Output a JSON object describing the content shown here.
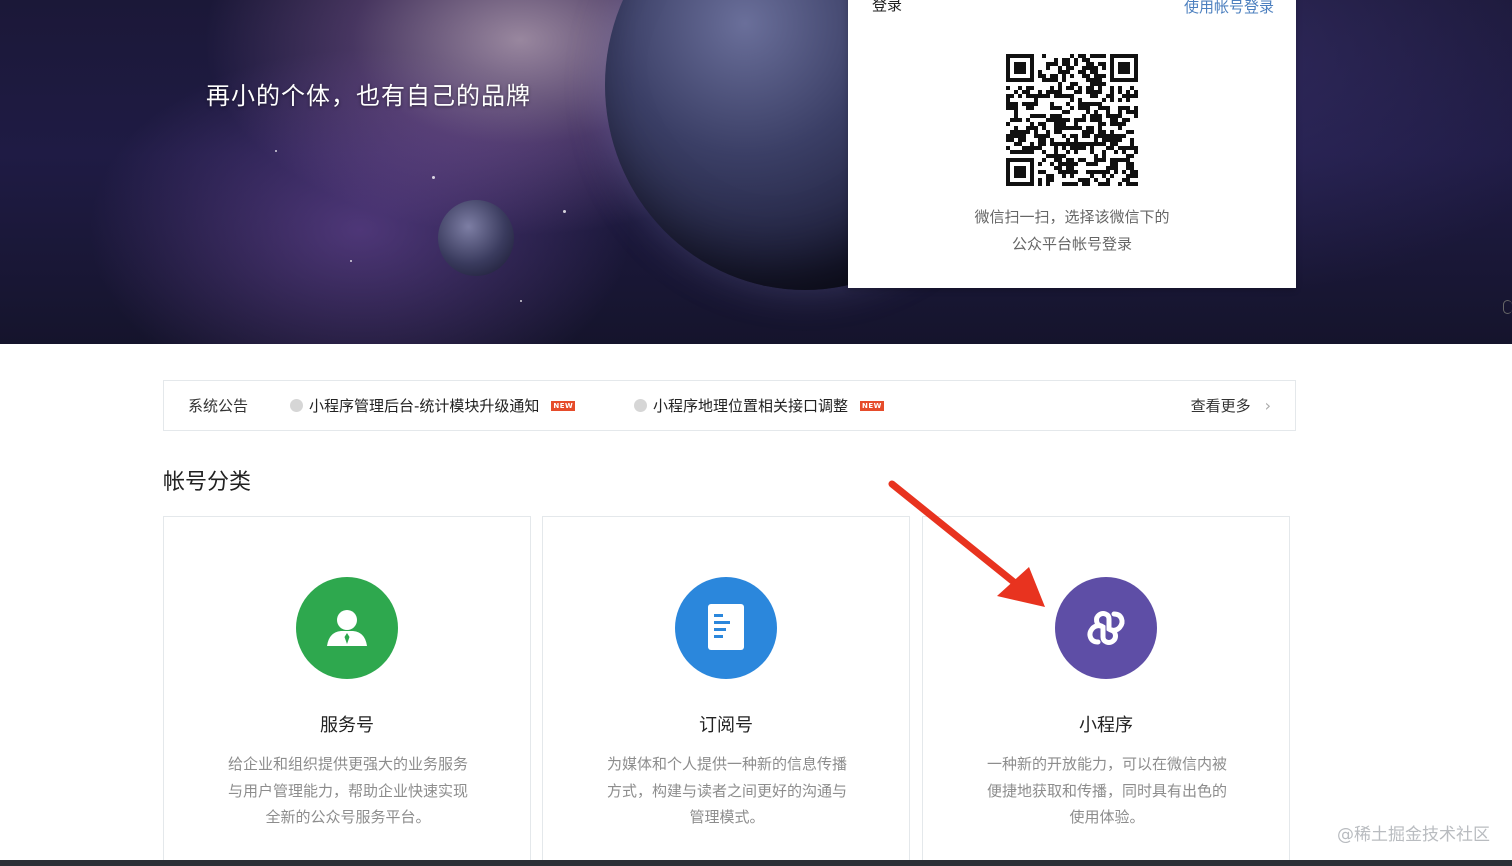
{
  "hero": {
    "slogan": "再小的个体，也有自己的品牌"
  },
  "login": {
    "title": "登录",
    "switch_link": "使用帐号登录",
    "qr_hint_line1": "微信扫一扫，选择该微信下的",
    "qr_hint_line2": "公众平台帐号登录"
  },
  "notices": {
    "label": "系统公告",
    "items": [
      {
        "text": "小程序管理后台-统计模块升级通知",
        "badge": "NEW"
      },
      {
        "text": "小程序地理位置相关接口调整",
        "badge": "NEW"
      }
    ],
    "more": "查看更多"
  },
  "section": {
    "title": "帐号分类"
  },
  "cards": [
    {
      "title": "服务号",
      "icon": "service-account-icon",
      "color": "#2ea84e",
      "desc_lines": [
        "给企业和组织提供更强大的业务服务",
        "与用户管理能力，帮助企业快速实现",
        "全新的公众号服务平台。"
      ]
    },
    {
      "title": "订阅号",
      "icon": "subscription-account-icon",
      "color": "#2b87dc",
      "desc_lines": [
        "为媒体和个人提供一种新的信息传播",
        "方式，构建与读者之间更好的沟通与",
        "管理模式。"
      ]
    },
    {
      "title": "小程序",
      "icon": "mini-program-icon",
      "color": "#5e4ea6",
      "desc_lines": [
        "一种新的开放能力，可以在微信内被",
        "便捷地获取和传播，同时具有出色的",
        "使用体验。"
      ]
    }
  ],
  "watermark": "@稀土掘金技术社区",
  "colors": {
    "link": "#4d80bf",
    "new_badge": "#e64c2b",
    "arrow": "#e8331f"
  }
}
